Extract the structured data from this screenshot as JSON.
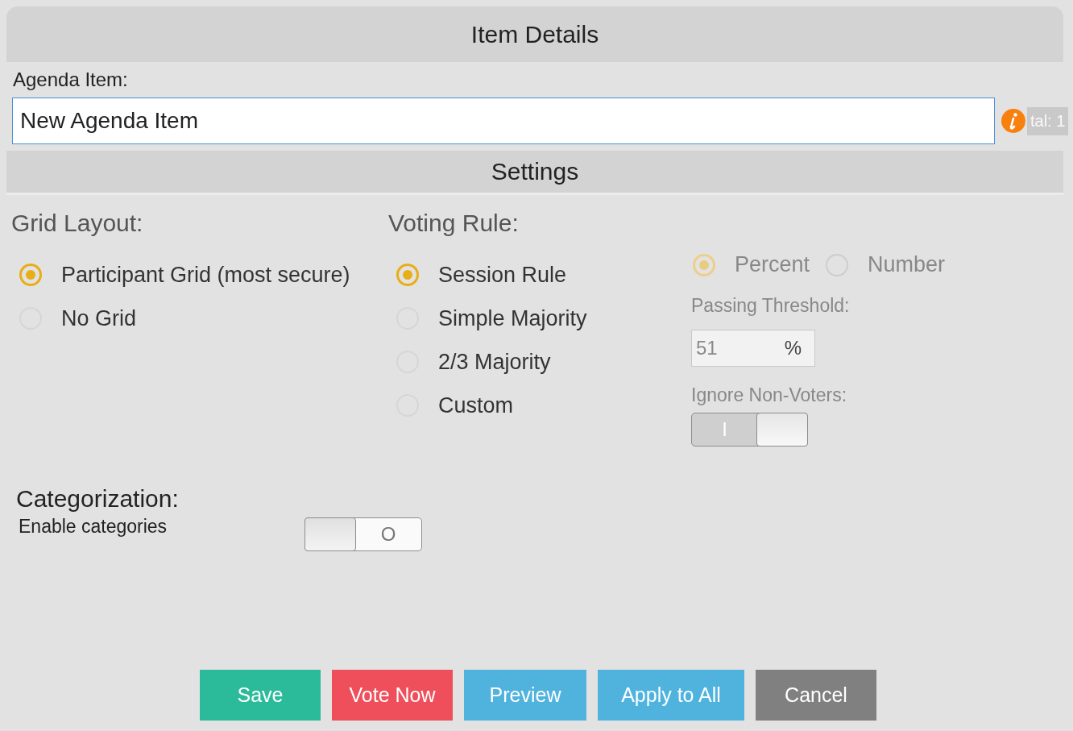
{
  "dialog": {
    "title": "Item Details"
  },
  "agenda_item": {
    "label": "Agenda Item:",
    "value": "New Agenda Item"
  },
  "background_text": "tal: 1",
  "settings": {
    "title": "Settings"
  },
  "grid_layout": {
    "label": "Grid Layout:",
    "options": [
      {
        "label": "Participant Grid (most secure)",
        "selected": true
      },
      {
        "label": "No Grid",
        "selected": false
      }
    ]
  },
  "voting_rule": {
    "label": "Voting Rule:",
    "options": [
      {
        "label": "Session Rule",
        "selected": true
      },
      {
        "label": "Simple Majority",
        "selected": false
      },
      {
        "label": "2/3 Majority",
        "selected": false
      },
      {
        "label": "Custom",
        "selected": false
      }
    ]
  },
  "threshold": {
    "disabled": true,
    "modes": [
      {
        "label": "Percent",
        "selected": true
      },
      {
        "label": "Number",
        "selected": false
      }
    ],
    "label": "Passing Threshold:",
    "value": "51",
    "unit": "%",
    "ignore_label": "Ignore Non-Voters:",
    "ignore_on": true,
    "ignore_glyph": "I"
  },
  "categorization": {
    "title": "Categorization:",
    "label": "Enable categories",
    "on": false,
    "glyph": "O"
  },
  "buttons": [
    {
      "label": "Save",
      "kind": "save"
    },
    {
      "label": "Vote Now",
      "kind": "vote"
    },
    {
      "label": "Preview",
      "kind": "preview"
    },
    {
      "label": "Apply to All",
      "kind": "apply"
    },
    {
      "label": "Cancel",
      "kind": "cancel"
    }
  ]
}
